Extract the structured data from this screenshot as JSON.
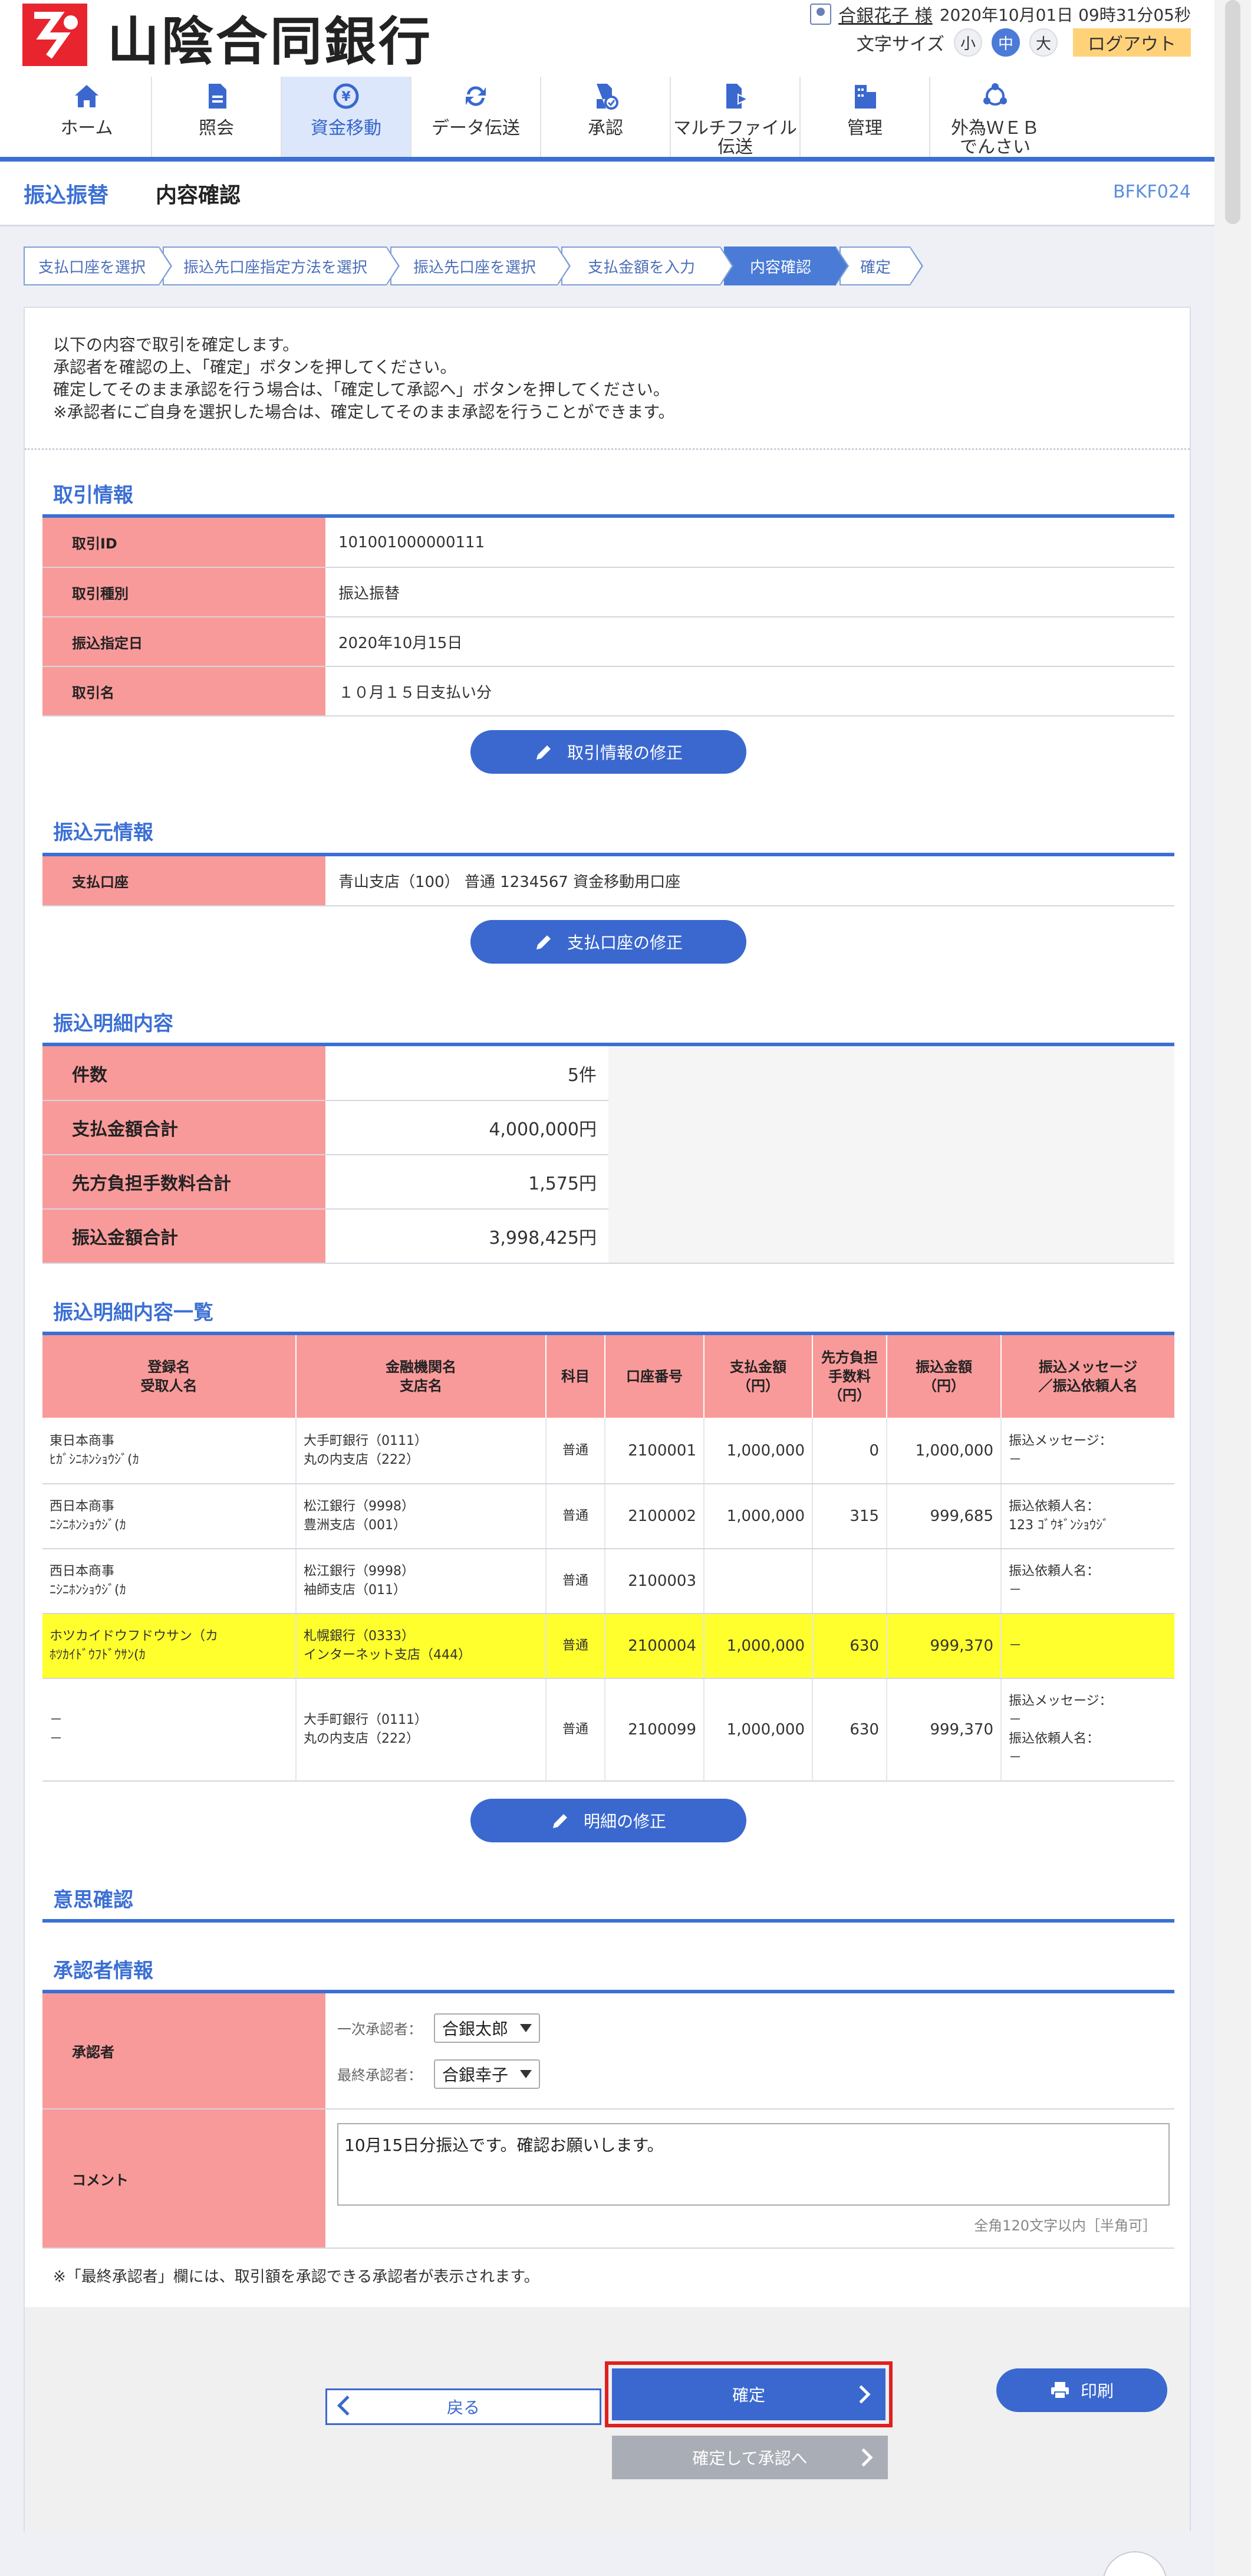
{
  "header": {
    "bank_name": "山陰合同銀行",
    "user_name": "合銀花子 様",
    "datetime": "2020年10月01日 09時31分05秒",
    "font_size_label": "文字サイズ",
    "font_sizes": [
      "小",
      "中",
      "大"
    ],
    "logout": "ログアウト"
  },
  "nav": [
    {
      "label": "ホーム",
      "icon": "home-icon"
    },
    {
      "label": "照会",
      "icon": "document-icon"
    },
    {
      "label": "資金移動",
      "icon": "yen-transfer-icon"
    },
    {
      "label": "データ伝送",
      "icon": "sync-icon"
    },
    {
      "label": "承認",
      "icon": "approve-icon"
    },
    {
      "label": "マルチファイル\n伝送",
      "icon": "file-send-icon"
    },
    {
      "label": "管理",
      "icon": "building-icon"
    },
    {
      "label": "外為ＷＥＢ\nでんさい",
      "icon": "network-icon"
    }
  ],
  "title": {
    "main": "振込振替",
    "sub": "内容確認",
    "page_id": "BFKF024"
  },
  "steps": [
    "支払口座を選択",
    "振込先口座指定方法を選択",
    "振込先口座を選択",
    "支払金額を入力",
    "内容確認",
    "確定"
  ],
  "intro": [
    "以下の内容で取引を確定します。",
    "承認者を確認の上、「確定」ボタンを押してください。",
    "確定してそのまま承認を行う場合は、「確定して承認へ」ボタンを押してください。",
    "※承認者にご自身を選択した場合は、確定してそのまま承認を行うことができます。"
  ],
  "trade": {
    "heading": "取引情報",
    "rows": [
      {
        "k": "取引ID",
        "v": "101001000000111"
      },
      {
        "k": "取引種別",
        "v": "振込振替"
      },
      {
        "k": "振込指定日",
        "v": "2020年10月15日"
      },
      {
        "k": "取引名",
        "v": "１０月１５日支払い分"
      }
    ],
    "edit_btn": "取引情報の修正"
  },
  "source": {
    "heading": "振込元情報",
    "rows": [
      {
        "k": "支払口座",
        "v": "青山支店（100） 普通 1234567 資金移動用口座"
      }
    ],
    "edit_btn": "支払口座の修正"
  },
  "summary": {
    "heading": "振込明細内容",
    "rows": [
      {
        "k": "件数",
        "v": "5件"
      },
      {
        "k": "支払金額合計",
        "v": "4,000,000円"
      },
      {
        "k": "先方負担手数料合計",
        "v": "1,575円"
      },
      {
        "k": "振込金額合計",
        "v": "3,998,425円"
      }
    ]
  },
  "detail": {
    "heading": "振込明細内容一覧",
    "columns": [
      "登録名\n受取人名",
      "金融機関名\n支店名",
      "科目",
      "口座番号",
      "支払金額\n（円）",
      "先方負担\n手数料\n（円）",
      "振込金額\n（円）",
      "振込メッセージ\n／振込依頼人名"
    ],
    "rows": [
      {
        "name": "東日本商事\nﾋｶﾞｼﾆﾎﾝｼｮｳｼﾞ(ｶ",
        "bank": "大手町銀行（0111）\n丸の内支店（222）",
        "type": "普通",
        "acct": "2100001",
        "pay": "1,000,000",
        "fee": "0",
        "amount": "1,000,000",
        "msg": "振込メッセージ：\n－",
        "highlight": false
      },
      {
        "name": "西日本商事\nﾆｼﾆﾎﾝｼｮｳｼﾞ(ｶ",
        "bank": "松江銀行（9998）\n豊洲支店（001）",
        "type": "普通",
        "acct": "2100002",
        "pay": "1,000,000",
        "fee": "315",
        "amount": "999,685",
        "msg": "振込依頼人名：\n123 ｺﾞｳｷﾞﾝｼｮｳｼﾞ",
        "highlight": false
      },
      {
        "name": "西日本商事\nﾆｼﾆﾎﾝｼｮｳｼﾞ(ｶ",
        "bank": "松江銀行（9998）\n袖師支店（011）",
        "type": "普通",
        "acct": "2100003",
        "pay": "",
        "fee": "",
        "amount": "",
        "msg": "振込依頼人名：\n－",
        "highlight": false
      },
      {
        "name": "ホツカイドウフドウサン（カ\nﾎﾂｶｲﾄﾞｳﾌﾄﾞｳｻﾝ(ｶ",
        "bank": "札幌銀行（0333）\nインターネット支店（444）",
        "type": "普通",
        "acct": "2100004",
        "pay": "1,000,000",
        "fee": "630",
        "amount": "999,370",
        "msg": "－",
        "highlight": true
      },
      {
        "name": "－\n－",
        "bank": "大手町銀行（0111）\n丸の内支店（222）",
        "type": "普通",
        "acct": "2100099",
        "pay": "1,000,000",
        "fee": "630",
        "amount": "999,370",
        "msg": "振込メッセージ：\n－\n振込依頼人名：\n－",
        "highlight": false
      }
    ],
    "edit_btn": "明細の修正"
  },
  "intent": {
    "heading": "意思確認"
  },
  "approver": {
    "heading": "承認者情報",
    "approver_label": "承認者",
    "first_label": "一次承認者：",
    "first_value": "合銀太郎",
    "final_label": "最終承認者：",
    "final_value": "合銀幸子",
    "comment_label": "コメント",
    "comment_value": "10月15日分振込です。確認お願いします。",
    "comment_hint": "全角120文字以内［半角可］",
    "note": "※「最終承認者」欄には、取引額を承認できる承認者が表示されます。"
  },
  "footer": {
    "back": "戻る",
    "confirm": "確定",
    "confirm_approve": "確定して承認へ",
    "print": "印刷"
  },
  "colors": {
    "brand_red": "#e8242f",
    "primary_blue": "#3a68cf",
    "label_pink": "#f99a9a",
    "highlight_yellow": "#ffff2e"
  }
}
